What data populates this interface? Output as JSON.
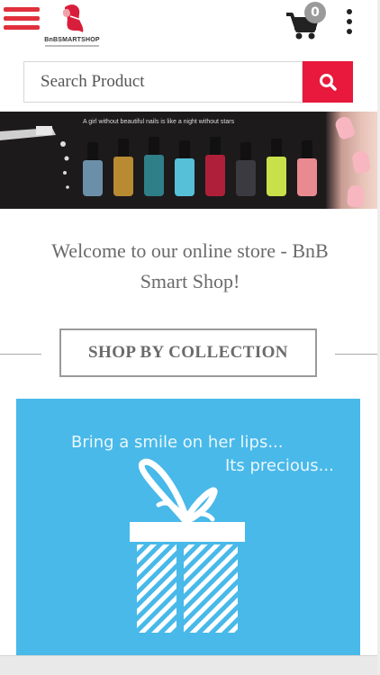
{
  "header": {
    "logo_text": "BnBSMARTSHOP",
    "cart_count": "0"
  },
  "search": {
    "placeholder": "Search Product"
  },
  "banner": {
    "caption": "A girl without beautiful nails is like a night without stars",
    "colors": [
      "#6b8fa8",
      "#b88a32",
      "#2f7f89",
      "#56c0d8",
      "#b01f3a",
      "#3a3a40",
      "#c8e04a",
      "#e98a90"
    ]
  },
  "welcome": {
    "line1": "Welcome to our online store - BnB",
    "line2": "Smart Shop!"
  },
  "collection": {
    "heading": "SHOP BY COLLECTION"
  },
  "promo": {
    "line1": "Bring a smile on her lips...",
    "line2": "Its precious...",
    "bg_color": "#48b9e9"
  },
  "accent_color": "#e8193c"
}
